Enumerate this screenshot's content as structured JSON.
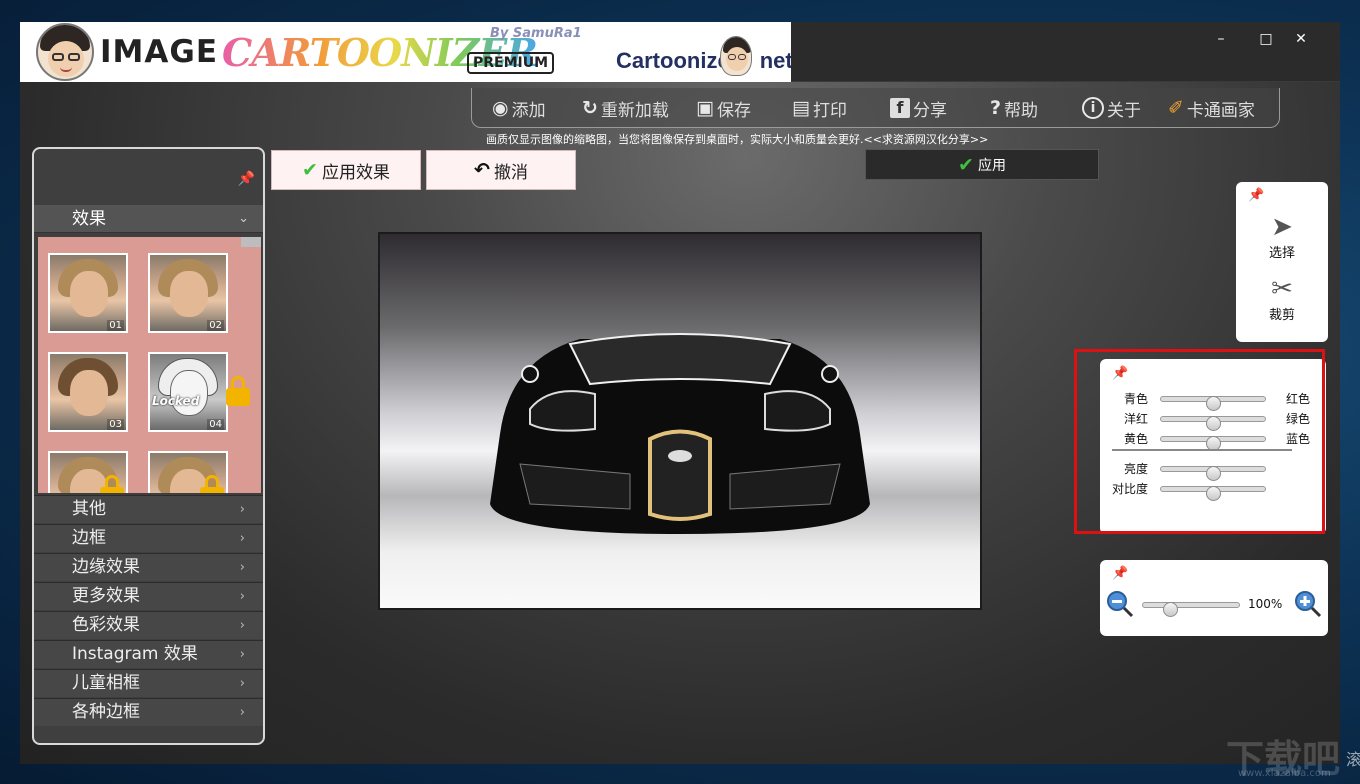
{
  "banner": {
    "logo_word1": "IMAGE",
    "logo_word2": "CARTOONIZER",
    "byline": "By SamuRa1",
    "edition": "PREMIUM",
    "site_part1": "Cartoonize",
    "site_part2": "net"
  },
  "window_controls": {
    "minimize": "–",
    "maximize": "□",
    "close": "✕"
  },
  "toolbar": [
    {
      "label": "添加",
      "icon": "camera-add-icon"
    },
    {
      "label": "重新加载",
      "icon": "reload-icon"
    },
    {
      "label": "保存",
      "icon": "save-icon"
    },
    {
      "label": "打印",
      "icon": "printer-icon"
    },
    {
      "label": "分享",
      "icon": "facebook-icon"
    },
    {
      "label": "帮助",
      "icon": "question-icon"
    },
    {
      "label": "关于",
      "icon": "info-icon"
    },
    {
      "label": "卡通画家",
      "icon": "paintbrush-icon"
    }
  ],
  "hint": "画质仅显示图像的缩略图，当您将图像保存到桌面时，实际大小和质量会更好.<<求资源网汉化分享>>",
  "actions": {
    "apply_effect": "应用效果",
    "undo": "撤消",
    "apply": "应用"
  },
  "left_panel": {
    "effects_header": "效果",
    "thumbnails": [
      {
        "num": "01",
        "locked": false
      },
      {
        "num": "02",
        "locked": false
      },
      {
        "num": "03",
        "locked": false
      },
      {
        "num": "04",
        "locked": true,
        "locked_label": "Locked"
      }
    ],
    "categories": [
      "其他",
      "边框",
      "边缘效果",
      "更多效果",
      "色彩效果",
      "Instagram 效果",
      "儿童相框",
      "各种边框"
    ]
  },
  "tools": {
    "select": "选择",
    "crop": "裁剪"
  },
  "color_adjust": {
    "sliders": [
      {
        "left": "青色",
        "right": "红色",
        "value": 0.5
      },
      {
        "left": "洋红",
        "right": "绿色",
        "value": 0.5
      },
      {
        "left": "黄色",
        "right": "蓝色",
        "value": 0.5
      },
      {
        "left": "亮度",
        "right": "",
        "value": 0.5
      },
      {
        "left": "对比度",
        "right": "",
        "value": 0.5
      }
    ]
  },
  "zoom": {
    "value_label": "100%",
    "level": 0.25
  },
  "watermark": {
    "main": "下载吧",
    "sub": "www.xiazaiba.com",
    "edge": "滚"
  },
  "colors": {
    "thumb_panel_bg": "#da9b94",
    "highlight_border": "#dd1111",
    "check_green": "#3fbf3f"
  }
}
